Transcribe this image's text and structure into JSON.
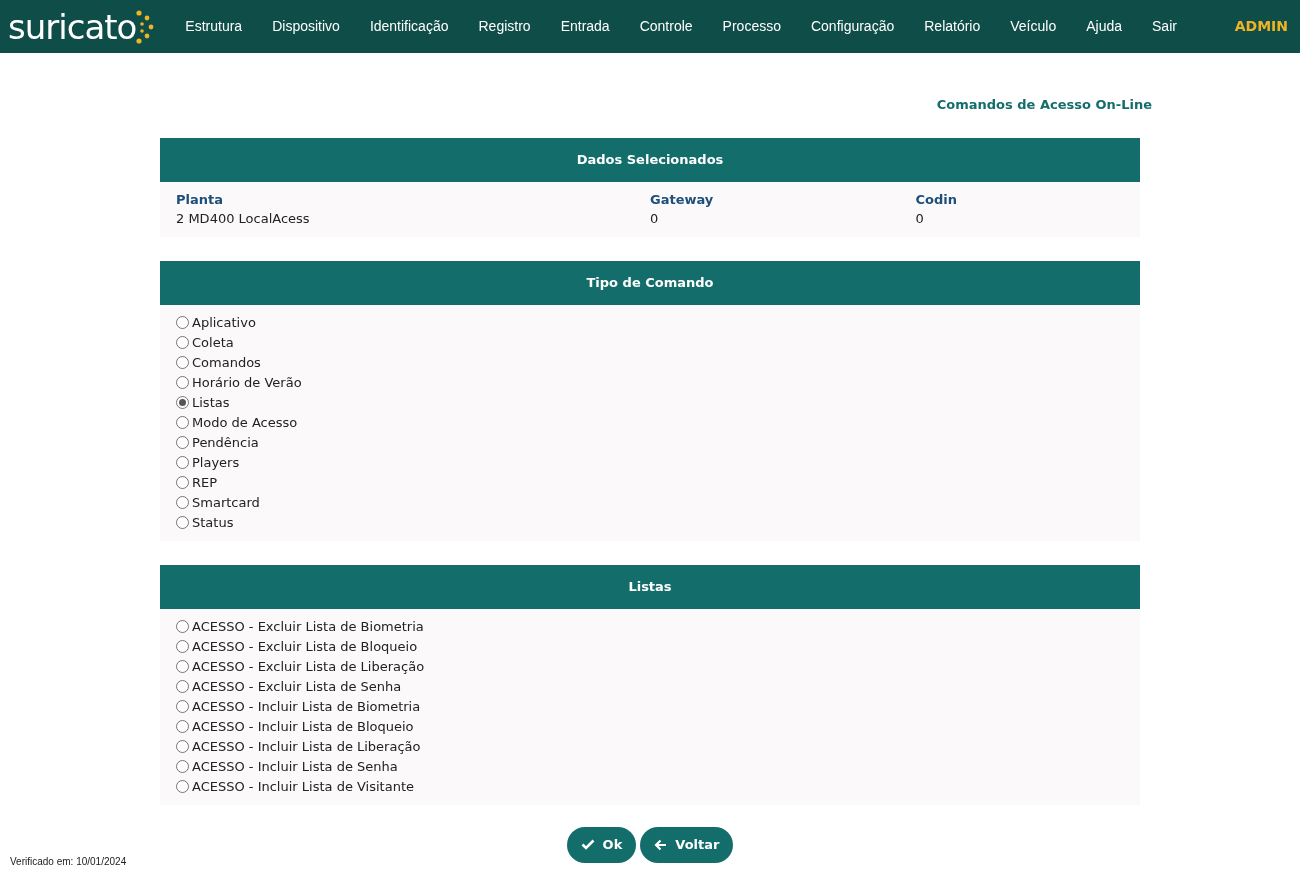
{
  "navbar": {
    "logo": "suricato",
    "items": [
      {
        "label": "Estrutura"
      },
      {
        "label": "Dispositivo"
      },
      {
        "label": "Identificação"
      },
      {
        "label": "Registro"
      },
      {
        "label": "Entrada"
      },
      {
        "label": "Controle"
      },
      {
        "label": "Processo"
      },
      {
        "label": "Configuração"
      },
      {
        "label": "Relatório"
      },
      {
        "label": "Veículo"
      },
      {
        "label": "Ajuda"
      },
      {
        "label": "Sair"
      }
    ],
    "user": "ADMIN"
  },
  "page_title": "Comandos de Acesso On-Line",
  "selected_data": {
    "title": "Dados Selecionados",
    "fields": [
      {
        "label": "Planta",
        "value": "2 MD400 LocalAcess"
      },
      {
        "label": "Gateway",
        "value": "0"
      },
      {
        "label": "Codin",
        "value": "0"
      }
    ]
  },
  "command_type": {
    "title": "Tipo de Comando",
    "options": [
      {
        "label": "Aplicativo",
        "selected": false
      },
      {
        "label": "Coleta",
        "selected": false
      },
      {
        "label": "Comandos",
        "selected": false
      },
      {
        "label": "Horário de Verão",
        "selected": false
      },
      {
        "label": "Listas",
        "selected": true
      },
      {
        "label": "Modo de Acesso",
        "selected": false
      },
      {
        "label": "Pendência",
        "selected": false
      },
      {
        "label": "Players",
        "selected": false
      },
      {
        "label": "REP",
        "selected": false
      },
      {
        "label": "Smartcard",
        "selected": false
      },
      {
        "label": "Status",
        "selected": false
      }
    ]
  },
  "lists": {
    "title": "Listas",
    "options": [
      {
        "label": "ACESSO - Excluir Lista de Biometria",
        "selected": false
      },
      {
        "label": "ACESSO - Excluir Lista de Bloqueio",
        "selected": false
      },
      {
        "label": "ACESSO - Excluir Lista de Liberação",
        "selected": false
      },
      {
        "label": "ACESSO - Excluir Lista de Senha",
        "selected": false
      },
      {
        "label": "ACESSO - Incluir Lista de Biometria",
        "selected": false
      },
      {
        "label": "ACESSO - Incluir Lista de Bloqueio",
        "selected": false
      },
      {
        "label": "ACESSO - Incluir Lista de Liberação",
        "selected": false
      },
      {
        "label": "ACESSO - Incluir Lista de Senha",
        "selected": false
      },
      {
        "label": "ACESSO - Incluir Lista de Visitante",
        "selected": false
      }
    ]
  },
  "buttons": [
    {
      "kind": "ok",
      "label": "Ok"
    },
    {
      "kind": "back",
      "label": "Voltar"
    }
  ],
  "footer": "Verificado em: 10/01/2024"
}
